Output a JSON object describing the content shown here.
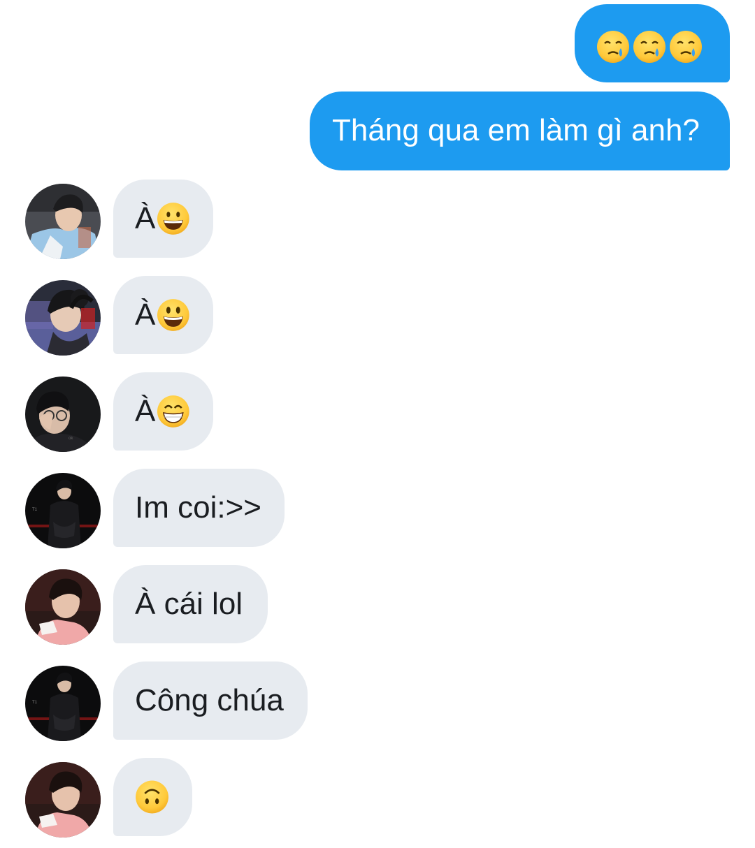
{
  "outgoing": [
    {
      "text": "",
      "emojis": [
        "face-holding-back-tears-emoji",
        "face-holding-back-tears-emoji",
        "face-holding-back-tears-emoji"
      ]
    },
    {
      "text": "Tháng qua em làm gì anh?"
    }
  ],
  "incoming": [
    {
      "text": "À",
      "emoji": "grinning-face-emoji",
      "avatar": "avatar-1-icon"
    },
    {
      "text": "À",
      "emoji": "smiley-face-emoji",
      "avatar": "avatar-2-icon"
    },
    {
      "text": "À",
      "emoji": "grin-squint-face-emoji",
      "avatar": "avatar-3-icon"
    },
    {
      "text": "Im coi:>>",
      "avatar": "avatar-4-icon"
    },
    {
      "text": "À cái lol",
      "avatar": "avatar-5-icon"
    },
    {
      "text": "Công chúa",
      "avatar": "avatar-4-icon"
    },
    {
      "text": "",
      "emoji": "upside-down-face-emoji",
      "avatar": "avatar-5-icon"
    }
  ],
  "colors": {
    "outgoing_bubble": "#1d9bf0",
    "incoming_bubble": "#e7ebf0",
    "text_dark": "#1a1d21",
    "text_light": "#ffffff"
  }
}
